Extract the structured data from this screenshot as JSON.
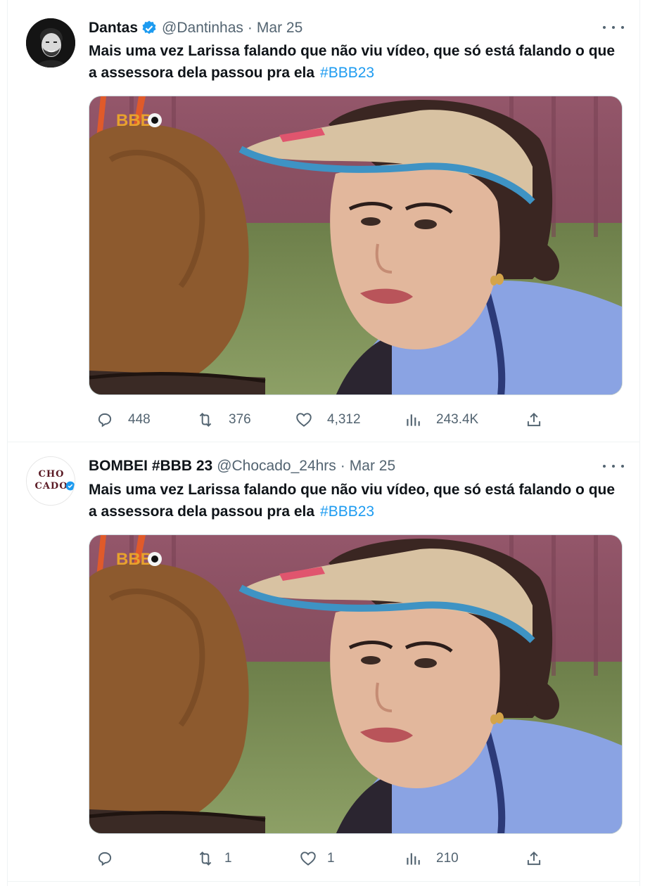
{
  "tweets": [
    {
      "name": "Dantas",
      "handle": "@Dantinhas",
      "separator": "·",
      "date": "Mar 25",
      "text": "Mais uma vez Larissa falando que não viu vídeo, que só está falando o que a assessora dela passou pra ela",
      "hashtag": "#BBB23",
      "media_logo": "BBB",
      "verified": true,
      "avatar_icon": "bearded-man-avatar",
      "stats": {
        "replies": "448",
        "retweets": "376",
        "likes": "4,312",
        "views": "243.4K"
      }
    },
    {
      "name": "BOMBEI #BBB 23",
      "handle": "@Chocado_24hrs",
      "separator": "·",
      "date": "Mar 25",
      "text": "Mais uma vez Larissa falando que não viu vídeo, que só está falando o que a assessora dela passou pra ela",
      "hashtag": "#BBB23",
      "media_logo": "BBB",
      "verified": false,
      "avatar_text": {
        "line1": "CHO",
        "line2": "CADO"
      },
      "stats": {
        "replies": "",
        "retweets": "1",
        "likes": "1",
        "views": "210"
      }
    }
  ],
  "colors": {
    "accent": "#1d9bf0",
    "secondary_text": "#536471",
    "border": "#eff3f4"
  },
  "icons": [
    "reply-icon",
    "retweet-icon",
    "like-icon",
    "views-icon",
    "share-icon",
    "more-icon",
    "verified-badge-icon"
  ]
}
